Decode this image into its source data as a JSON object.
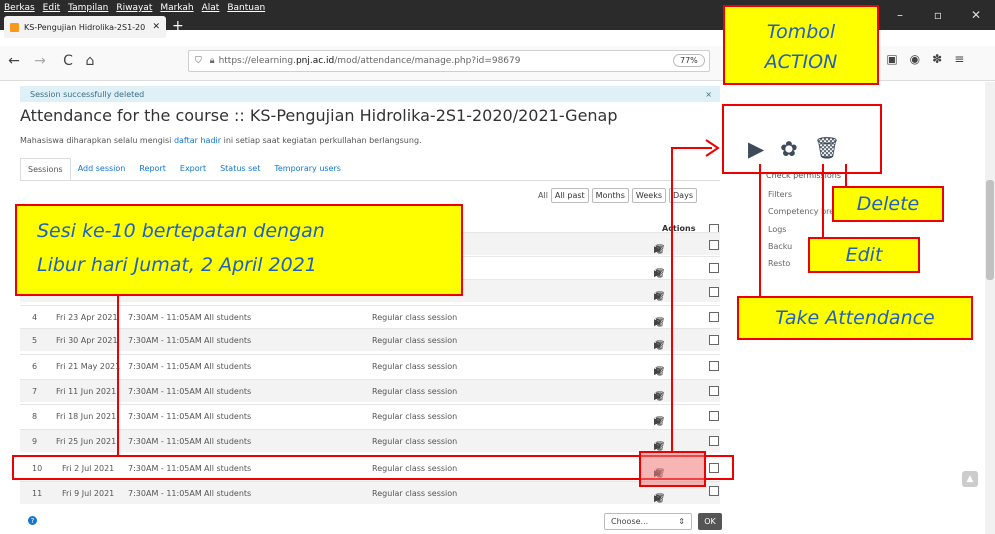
{
  "menu": [
    "Berkas",
    "Edit",
    "Tampilan",
    "Riwayat",
    "Markah",
    "Alat",
    "Bantuan"
  ],
  "window_controls": [
    "–",
    "▫",
    "✕"
  ],
  "tab": {
    "label": "KS-Pengujian Hidrolika-2S1-20",
    "close": "✕",
    "new": "+"
  },
  "nav": {
    "back": "←",
    "forward": "→",
    "reload": "C",
    "home": "⌂"
  },
  "url": {
    "prefix": "https://elearning.",
    "domain": "pnj.ac.id",
    "path": "/mod/attendance/manage.php?id=98679"
  },
  "zoom": "77%",
  "alert": {
    "text": "Session successfully deleted",
    "close": "×"
  },
  "page_title": "Attendance for the course :: KS-Pengujian Hidrolika-2S1-2020/2021-Genap",
  "notice": {
    "before": "Mahasiswa diharapkan selalu mengisi ",
    "link": "daftar hadir",
    "after": " ini setiap saat kegiatan perkullahan berlangsung."
  },
  "subtabs": [
    "Sessions",
    "Add session",
    "Report",
    "Export",
    "Status set",
    "Temporary users"
  ],
  "filters": {
    "all": "All",
    "buttons": [
      "All past",
      "Months",
      "Weeks",
      "Days"
    ]
  },
  "actions_header": "Actions",
  "rows": [
    {
      "num": "4",
      "date": "Fri 23 Apr 2021",
      "time": "7:30AM - 11:05AM",
      "group": "All students",
      "desc": "Regular class session"
    },
    {
      "num": "5",
      "date": "Fri 30 Apr 2021",
      "time": "7:30AM - 11:05AM",
      "group": "All students",
      "desc": "Regular class session"
    },
    {
      "num": "6",
      "date": "Fri 21 May 2021",
      "time": "7:30AM - 11:05AM",
      "group": "All students",
      "desc": "Regular class session"
    },
    {
      "num": "7",
      "date": "Fri 11 Jun 2021",
      "time": "7:30AM - 11:05AM",
      "group": "All students",
      "desc": "Regular class session"
    },
    {
      "num": "8",
      "date": "Fri 18 Jun 2021",
      "time": "7:30AM - 11:05AM",
      "group": "All students",
      "desc": "Regular class session"
    },
    {
      "num": "9",
      "date": "Fri 25 Jun 2021",
      "time": "7:30AM - 11:05AM",
      "group": "All students",
      "desc": "Regular class session"
    },
    {
      "num": "10",
      "date": "Fri 2 Jul 2021",
      "time": "7:30AM - 11:05AM",
      "group": "All students",
      "desc": "Regular class session"
    },
    {
      "num": "11",
      "date": "Fri 9 Jul 2021",
      "time": "7:30AM - 11:05AM",
      "group": "All students",
      "desc": "Regular class session"
    }
  ],
  "sidebar": {
    "items": [
      "Check permissions",
      "Filters",
      "Competency bre",
      "Logs",
      "Backu",
      "Resto"
    ]
  },
  "bottom": {
    "choose": "Choose...",
    "ok": "OK"
  },
  "annotations": {
    "tombol": [
      "Tombol",
      "ACTION"
    ],
    "sesi": [
      "Sesi ke-10 bertepatan dengan",
      "Libur hari Jumat, 2 April 2021"
    ],
    "delete": "Delete",
    "edit": "Edit",
    "take": "Take Attendance"
  },
  "colors": {
    "annotation_fill": "#ffff00",
    "annotation_border": "#ee0000",
    "annotation_text": "#2060c0",
    "link": "#1177d1"
  }
}
